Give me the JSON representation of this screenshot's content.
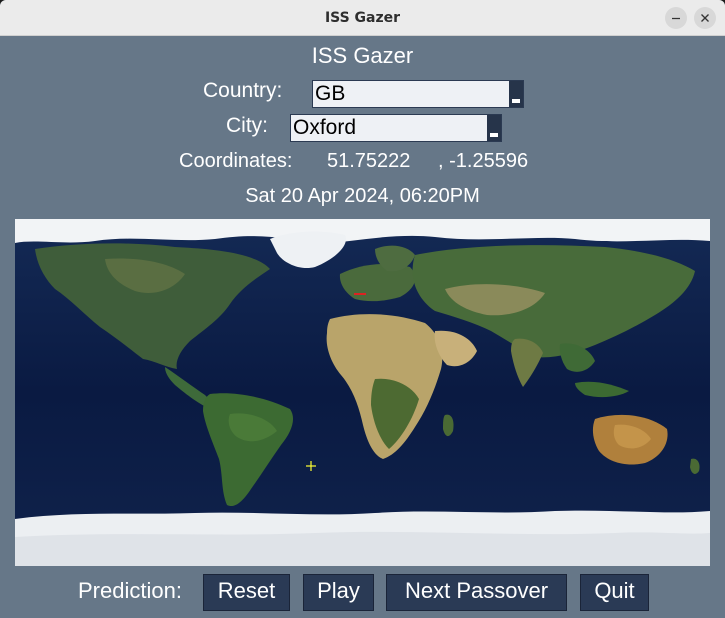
{
  "window": {
    "title": "ISS Gazer"
  },
  "app": {
    "heading": "ISS Gazer"
  },
  "country": {
    "label": "Country:",
    "value": "GB"
  },
  "city": {
    "label": "City:",
    "value": "Oxford"
  },
  "coordinates": {
    "label": "Coordinates:",
    "latitude": "51.75222",
    "longitude": ", -1.25596"
  },
  "datetime": "Sat 20 Apr 2024, 06:20PM",
  "map": {
    "iss_marker_color": "#ffff33",
    "location_marker_color": "#dd2222"
  },
  "controls": {
    "prediction_label": "Prediction:",
    "reset_label": "Reset",
    "play_label": "Play",
    "next_passover_label": "Next Passover",
    "quit_label": "Quit"
  },
  "colors": {
    "background": "#667788",
    "button_bg": "#2a3a55",
    "input_bg": "#eef1f5"
  }
}
